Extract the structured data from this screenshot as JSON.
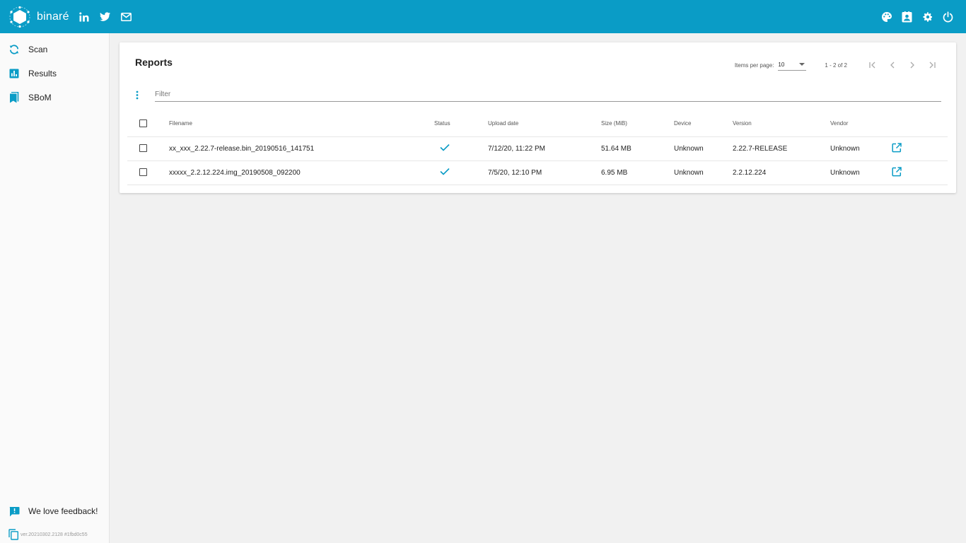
{
  "app": {
    "brand_name": "binaré",
    "accent": "#0a9cc6",
    "social_icons": [
      "linkedin-icon",
      "twitter-icon",
      "mail-icon"
    ],
    "actions": [
      "palette-icon",
      "account-box-icon",
      "gear-icon",
      "power-icon"
    ]
  },
  "sidebar": {
    "items": [
      {
        "label": "Scan",
        "icon": "sync-icon"
      },
      {
        "label": "Results",
        "icon": "bar-chart-icon"
      },
      {
        "label": "SBoM",
        "icon": "bookmark-icon"
      }
    ],
    "feedback_label": "We love feedback!",
    "version_text": "ver.20210302.2128 #1fbd0c55"
  },
  "reports": {
    "title": "Reports",
    "paginator": {
      "items_per_page_label": "Items per page:",
      "items_per_page_value": "10",
      "range_label": "1 - 2 of 2"
    },
    "filter_placeholder": "Filter",
    "filter_value": "",
    "columns": {
      "filename": "Filename",
      "status": "Status",
      "upload_date": "Upload date",
      "size": "Size (MiB)",
      "device": "Device",
      "version": "Version",
      "vendor": "Vendor"
    },
    "rows": [
      {
        "filename": "xx_xxx_2.22.7-release.bin_20190516_141751",
        "status": "done",
        "upload_date": "7/12/20, 11:22 PM",
        "size": "51.64 MB",
        "device": "Unknown",
        "version": "2.22.7-RELEASE",
        "vendor": "Unknown"
      },
      {
        "filename": "xxxxx_2.2.12.224.img_20190508_092200",
        "status": "done",
        "upload_date": "7/5/20, 12:10 PM",
        "size": "6.95 MB",
        "device": "Unknown",
        "version": "2.2.12.224",
        "vendor": "Unknown"
      }
    ]
  }
}
